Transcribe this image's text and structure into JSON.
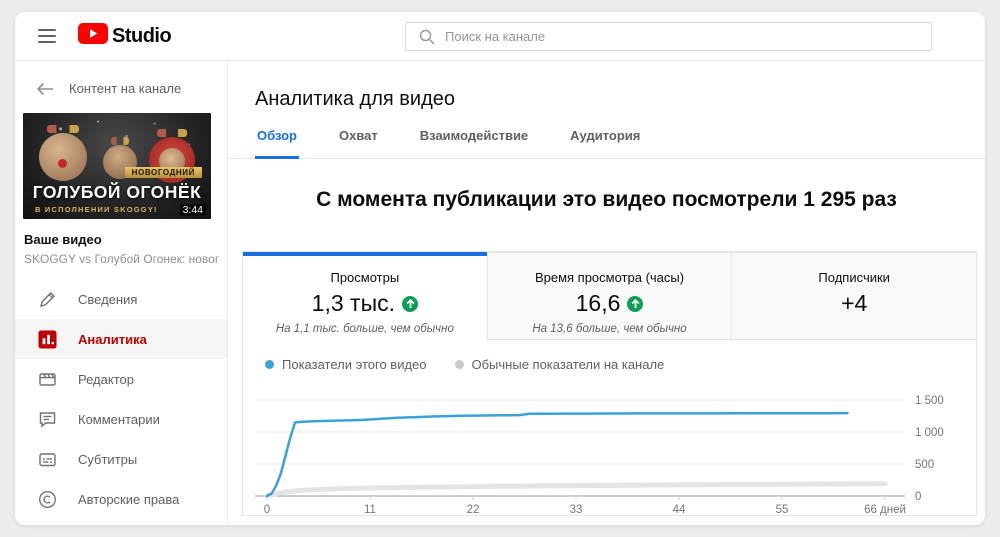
{
  "topbar": {
    "brand": "Studio",
    "search_placeholder": "Поиск на канале"
  },
  "sidebar": {
    "back_label": "Контент на канале",
    "thumbnail": {
      "banner": "НОВОГОДНИЙ",
      "title": "ГОЛУБОЙ ОГОНЁК",
      "subtitle": "В ИСПОЛНЕНИИ SKOGGY!",
      "duration": "3:44"
    },
    "video_label": "Ваше видео",
    "video_title": "SKOGGY vs Голубой Огонек: новог...",
    "items": [
      {
        "label": "Сведения",
        "icon": "pencil-icon",
        "active": false
      },
      {
        "label": "Аналитика",
        "icon": "analytics-icon",
        "active": true
      },
      {
        "label": "Редактор",
        "icon": "editor-icon",
        "active": false
      },
      {
        "label": "Комментарии",
        "icon": "comments-icon",
        "active": false
      },
      {
        "label": "Субтитры",
        "icon": "subtitles-icon",
        "active": false
      },
      {
        "label": "Авторские права",
        "icon": "copyright-icon",
        "active": false
      }
    ]
  },
  "main": {
    "title": "Аналитика для видео",
    "tabs": [
      {
        "label": "Обзор",
        "active": true
      },
      {
        "label": "Охват",
        "active": false
      },
      {
        "label": "Взаимодействие",
        "active": false
      },
      {
        "label": "Аудитория",
        "active": false
      }
    ],
    "headline": "С момента публикации это видео посмотрели 1 295 раз",
    "metrics": [
      {
        "label": "Просмотры",
        "value": "1,3 тыс.",
        "trend": "up",
        "note": "На 1,1 тыс. больше, чем обычно",
        "active": true
      },
      {
        "label": "Время просмотра (часы)",
        "value": "16,6",
        "trend": "up",
        "note": "На 13,6 больше, чем обычно",
        "active": false
      },
      {
        "label": "Подписчики",
        "value": "+4",
        "trend": null,
        "note": "",
        "active": false
      }
    ],
    "legend": [
      {
        "label": "Показатели этого видео",
        "color": "#3aa2d9"
      },
      {
        "label": "Обычные показатели на канале",
        "color": "#c9c9c9"
      }
    ]
  },
  "chart_data": {
    "type": "line",
    "xlim": [
      0,
      66
    ],
    "ylim": [
      0,
      1500
    ],
    "grid": true,
    "legend_position": "top-left",
    "x_ticks": [
      {
        "day": 0,
        "label": "0"
      },
      {
        "day": 11,
        "label": "11"
      },
      {
        "day": 22,
        "label": "22"
      },
      {
        "day": 33,
        "label": "33"
      },
      {
        "day": 44,
        "label": "44"
      },
      {
        "day": 55,
        "label": "55"
      },
      {
        "day": 66,
        "label": "66 дней"
      }
    ],
    "y_ticks": [
      {
        "value": 0,
        "label": "0"
      },
      {
        "value": 500,
        "label": "500"
      },
      {
        "value": 1000,
        "label": "1 000"
      },
      {
        "value": 1500,
        "label": "1 500"
      }
    ],
    "series": [
      {
        "name": "Обычные показатели на канале",
        "color": "#e4e4e4",
        "width": 5,
        "points": [
          [
            0,
            0
          ],
          [
            1,
            35
          ],
          [
            2,
            60
          ],
          [
            3,
            78
          ],
          [
            4,
            90
          ],
          [
            5,
            98
          ],
          [
            6,
            105
          ],
          [
            8,
            115
          ],
          [
            10,
            122
          ],
          [
            12,
            128
          ],
          [
            15,
            135
          ],
          [
            18,
            141
          ],
          [
            21,
            146
          ],
          [
            25,
            152
          ],
          [
            30,
            159
          ],
          [
            35,
            165
          ],
          [
            40,
            170
          ],
          [
            45,
            175
          ],
          [
            50,
            179
          ],
          [
            55,
            183
          ],
          [
            60,
            187
          ],
          [
            66,
            192
          ]
        ]
      },
      {
        "name": "Показатели этого видео",
        "color": "#3aa2d9",
        "width": 2.5,
        "points": [
          [
            0,
            0
          ],
          [
            0.5,
            40
          ],
          [
            1,
            170
          ],
          [
            1.5,
            360
          ],
          [
            2,
            640
          ],
          [
            2.5,
            920
          ],
          [
            3,
            1150
          ],
          [
            4,
            1162
          ],
          [
            5,
            1168
          ],
          [
            6,
            1172
          ],
          [
            7,
            1176
          ],
          [
            8,
            1180
          ],
          [
            9,
            1184
          ],
          [
            10,
            1188
          ],
          [
            11,
            1196
          ],
          [
            12,
            1205
          ],
          [
            13,
            1214
          ],
          [
            14,
            1222
          ],
          [
            15,
            1228
          ],
          [
            16,
            1233
          ],
          [
            17,
            1238
          ],
          [
            18,
            1243
          ],
          [
            19,
            1247
          ],
          [
            20,
            1251
          ],
          [
            21,
            1254
          ],
          [
            22,
            1256
          ],
          [
            23,
            1258
          ],
          [
            24,
            1260
          ],
          [
            25,
            1261
          ],
          [
            26,
            1262
          ],
          [
            27,
            1264
          ],
          [
            27.5,
            1275
          ],
          [
            28,
            1284
          ],
          [
            29,
            1285
          ],
          [
            30,
            1286
          ],
          [
            32,
            1287
          ],
          [
            34,
            1288
          ],
          [
            36,
            1289
          ],
          [
            38,
            1289
          ],
          [
            40,
            1290
          ],
          [
            42,
            1290
          ],
          [
            45,
            1291
          ],
          [
            48,
            1291
          ],
          [
            50,
            1292
          ],
          [
            52,
            1292
          ],
          [
            55,
            1293
          ],
          [
            58,
            1294
          ],
          [
            60,
            1294
          ],
          [
            62,
            1295
          ]
        ]
      }
    ]
  },
  "colors": {
    "accent_blue": "#1a6fe0",
    "accent_red": "#cc0000",
    "trend_green": "#0f9d58",
    "line_blue": "#3aa2d9",
    "brand_red": "#ff0000"
  }
}
